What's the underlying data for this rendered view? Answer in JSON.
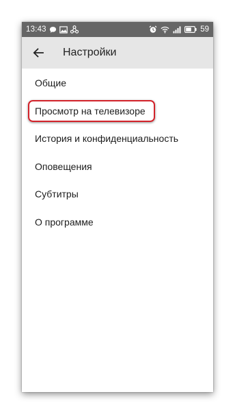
{
  "status_bar": {
    "time": "13:43",
    "battery_level": "59",
    "left_icons": [
      "chat-bubble-icon",
      "image-icon",
      "nodes-icon"
    ],
    "right_icons": [
      "alarm-clock-icon",
      "wifi-icon",
      "signal-icon",
      "battery-icon"
    ]
  },
  "toolbar": {
    "title": "Настройки",
    "back_icon": "arrow-left-icon"
  },
  "menu": {
    "items": [
      {
        "label": "Общие"
      },
      {
        "label": "Просмотр на телевизоре",
        "highlighted": true
      },
      {
        "label": "История и конфиденциальность"
      },
      {
        "label": "Оповещения"
      },
      {
        "label": "Субтитры"
      },
      {
        "label": "О программе"
      }
    ]
  },
  "colors": {
    "status_bar": "#666666",
    "toolbar": "#e6e6e6",
    "highlight_frame": "#d3222a"
  }
}
